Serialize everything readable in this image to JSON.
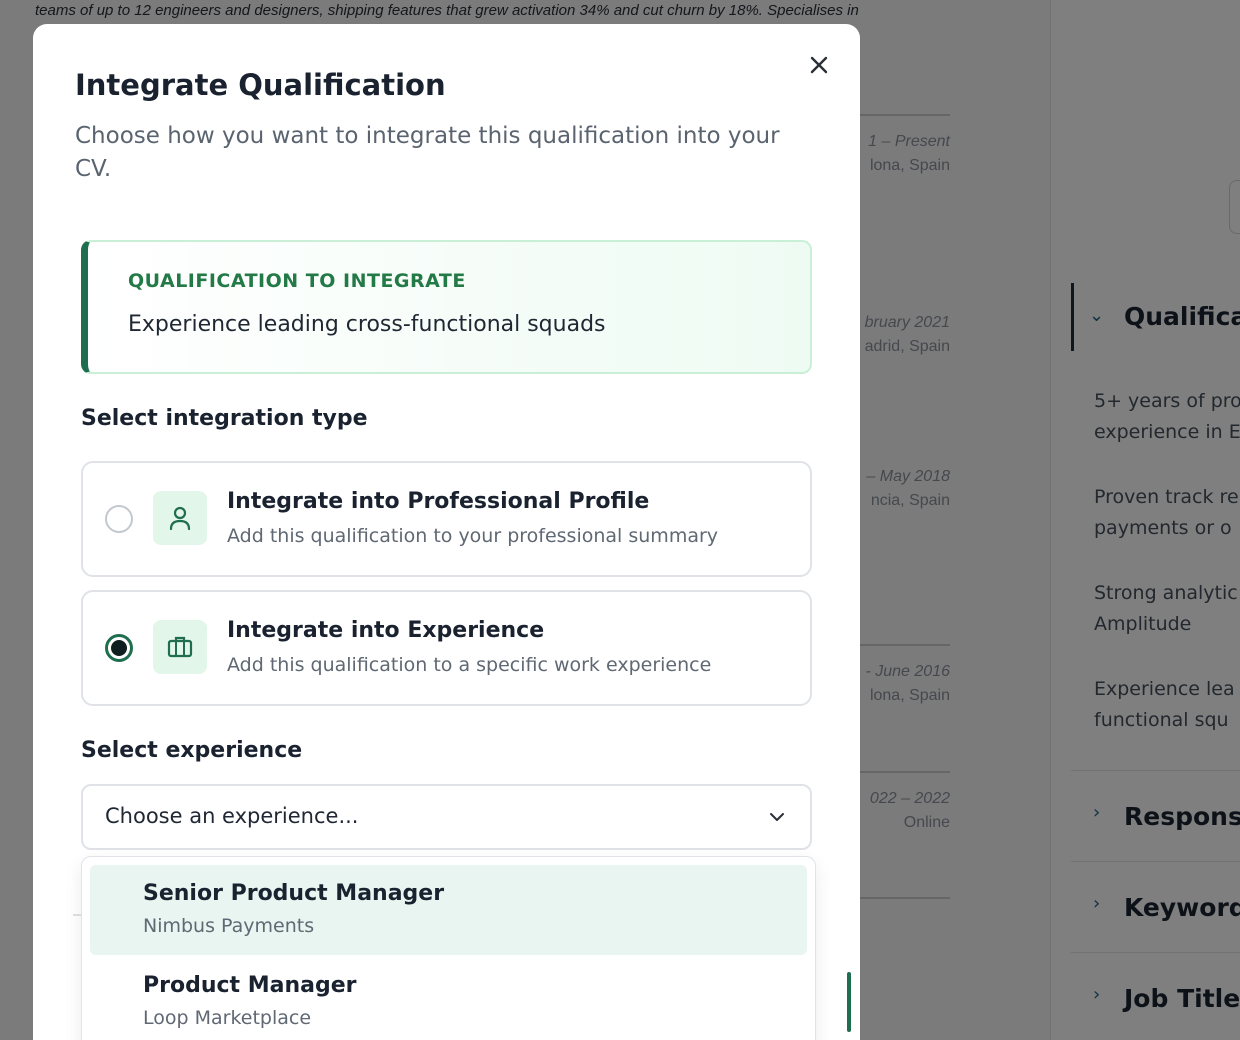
{
  "background": {
    "top_text": "teams of up to 12 engineers and designers, shipping features that grew activation 34% and cut churn by 18%. Specialises in",
    "date_blocks": [
      {
        "dates": "1 – Present",
        "location": "lona, Spain"
      },
      {
        "dates": "bruary 2021",
        "location": "adrid, Spain"
      },
      {
        "dates": "– May 2018",
        "location": "ncia, Spain"
      },
      {
        "dates": "- June 2016",
        "location": "lona, Spain"
      },
      {
        "dates": "022 – 2022",
        "location": "Online"
      }
    ],
    "right_panel": {
      "qualifications_heading": "Qualificat",
      "items": [
        {
          "line1": "5+ years of pro",
          "line2": "experience in E"
        },
        {
          "line1": "Proven track re",
          "line2": "payments or o"
        },
        {
          "line1": "Strong analytic",
          "line2": "Amplitude"
        },
        {
          "line1": "Experience lea",
          "line2": "functional squ"
        }
      ],
      "sections": [
        "Responsib",
        "Keywords",
        "Job Title"
      ]
    }
  },
  "modal": {
    "title": "Integrate Qualification",
    "subtitle": "Choose how you want to integrate this qualification into your CV.",
    "qualification": {
      "label": "QUALIFICATION TO INTEGRATE",
      "text": "Experience leading cross-functional squads"
    },
    "integration_type_title": "Select integration type",
    "options": [
      {
        "title": "Integrate into Professional Profile",
        "description": "Add this qualification to your professional summary",
        "selected": false,
        "icon": "user-icon"
      },
      {
        "title": "Integrate into Experience",
        "description": "Add this qualification to a specific work experience",
        "selected": true,
        "icon": "briefcase-icon"
      }
    ],
    "experience_title": "Select experience",
    "select_placeholder": "Choose an experience...",
    "dropdown_items": [
      {
        "title": "Senior Product Manager",
        "company": "Nimbus Payments",
        "highlighted": true
      },
      {
        "title": "Product Manager",
        "company": "Loop Marketplace",
        "highlighted": false
      }
    ]
  },
  "colors": {
    "accent_green": "#1f6e4f",
    "label_green": "#237a46",
    "icon_bg": "#e2f6e9",
    "highlight_bg": "#e8f5f1",
    "overlay": "rgba(0,0,0,0.5)"
  }
}
